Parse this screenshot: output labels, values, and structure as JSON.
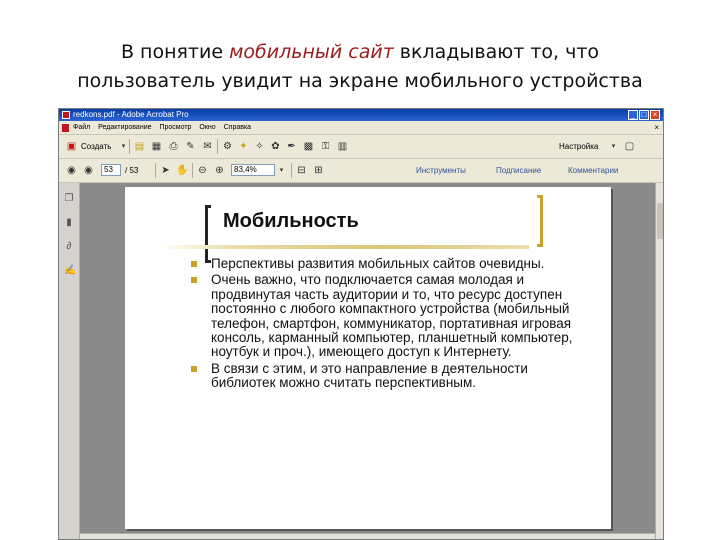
{
  "slide": {
    "title_part1": "В понятие ",
    "title_emphasis": "мобильный сайт",
    "title_part2": " вкладывают то, что",
    "title_line2": "пользователь увидит на экране мобильного устройства"
  },
  "window": {
    "title": "redkons.pdf - Adobe Acrobat Pro",
    "controls": {
      "minimize": "_",
      "maximize": "□",
      "close": "×"
    },
    "menus": [
      "Файл",
      "Редактирование",
      "Просмотр",
      "Окно",
      "Справка"
    ]
  },
  "toolbar1": {
    "create_label": "Создать",
    "customize_label": "Настройка"
  },
  "toolbar2": {
    "page_current": "53",
    "page_total": "/ 53",
    "zoom": "83,4%",
    "links": [
      "Инструменты",
      "Подписание",
      "Комментарии"
    ]
  },
  "pdf_page": {
    "heading": "Мобильность",
    "bullets": [
      "Перспективы развития мобильных сайтов очевидны.",
      "Очень важно, что подключается самая молодая и продвинутая часть аудитории и то, что ресурс доступен постоянно с любого компактного устройства (мобильный телефон, смартфон, коммуникатор, портативная игровая консоль, карманный компьютер, планшетный компьютер, ноутбук и проч.), имеющего доступ к Интернету.",
      "В связи с этим, и это направление в деятельности библиотек можно считать перспективным."
    ]
  },
  "colors": {
    "accent_red": "#9b1c1c",
    "bullet_gold": "#c9a22a",
    "titlebar_blue": "#0a3ea8"
  }
}
